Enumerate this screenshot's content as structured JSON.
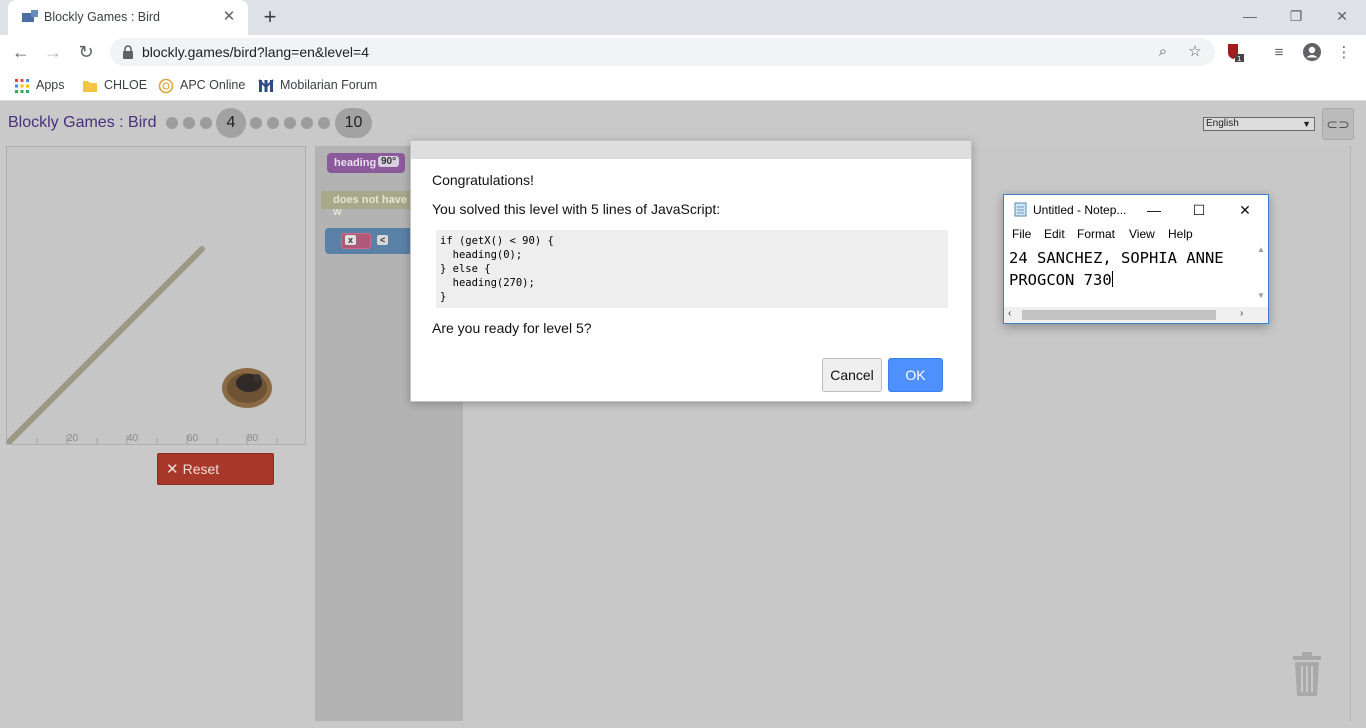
{
  "browser": {
    "tab_title": "Blockly Games : Bird",
    "url": "blockly.games/bird?lang=en&level=4",
    "bookmarks": [
      {
        "label": "Apps",
        "icon": "apps-grid-icon"
      },
      {
        "label": "CHLOE",
        "icon": "folder-icon"
      },
      {
        "label": "APC Online",
        "icon": "apc-logo-icon"
      },
      {
        "label": "Mobilarian Forum",
        "icon": "mobilarian-logo-icon"
      }
    ],
    "extension_badge": "1"
  },
  "game": {
    "title_part1": "Blockly Games",
    "title_sep": " : ",
    "title_part2": "Bird",
    "current_level": "4",
    "last_level": "10",
    "language": "English",
    "axis_ticks": [
      "20",
      "40",
      "60",
      "80"
    ],
    "reset_label": "Reset",
    "blocks": {
      "heading_label": "heading",
      "heading_value": "90°",
      "worm_label": "does not have w",
      "x_label": "x",
      "op_label": "<"
    }
  },
  "dialog": {
    "heading": "Congratulations!",
    "message": "You solved this level with 5 lines of JavaScript:",
    "code_lines": [
      "if (getX() < 90) {",
      "  heading(0);",
      "} else {",
      "  heading(270);",
      "}"
    ],
    "question": "Are you ready for level 5?",
    "cancel_label": "Cancel",
    "ok_label": "OK"
  },
  "notepad": {
    "title": "Untitled - Notep...",
    "menu": [
      "File",
      "Edit",
      "Format",
      "View",
      "Help"
    ],
    "lines": [
      "24 SANCHEZ, SOPHIA ANNE",
      "PROGCON 730"
    ]
  },
  "colors": {
    "reset": "#a8382a",
    "ok": "#4d90fe",
    "heading_block": "#8a5a9b",
    "title_purple": "#4a2f7a"
  }
}
